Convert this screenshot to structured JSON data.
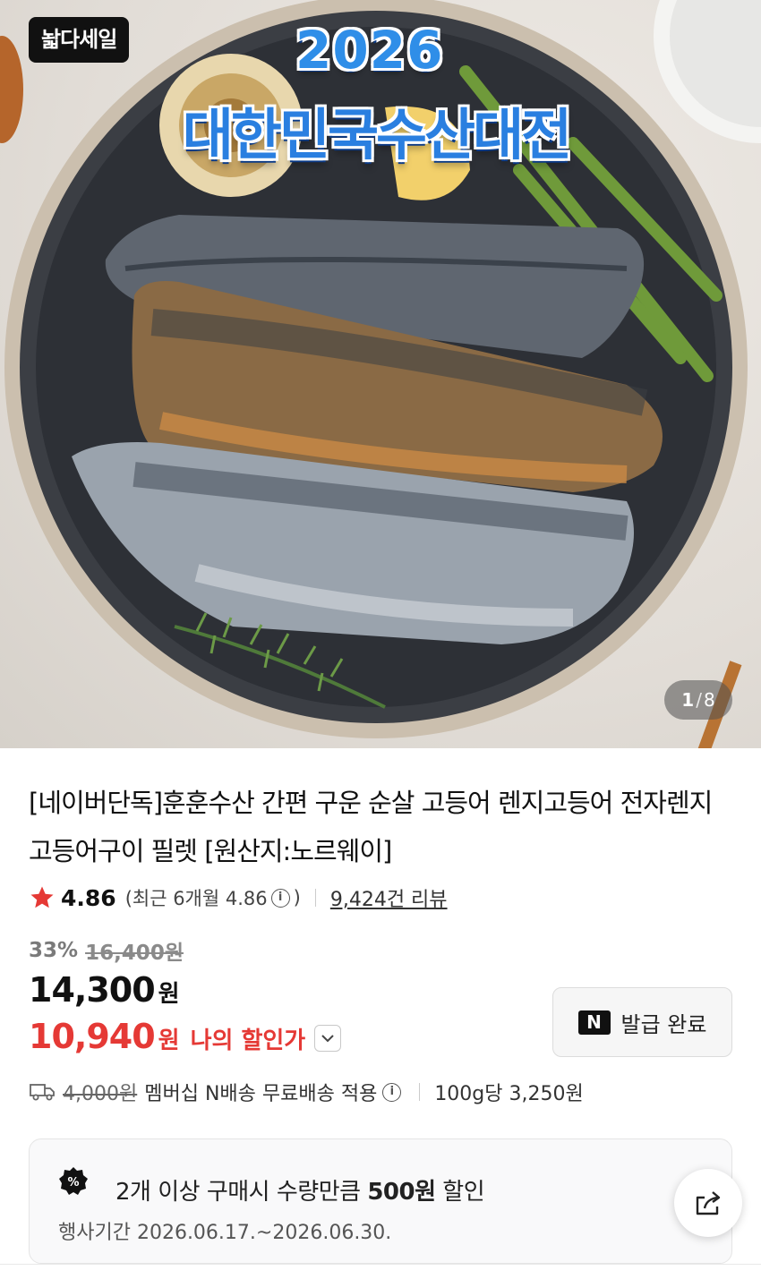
{
  "hero": {
    "badge": "놟다세일",
    "event_year": "2026",
    "event_title": "대한민국수산대전",
    "page_current": "1",
    "page_total": "8"
  },
  "product": {
    "title": "[네이버단독]훈훈수산 간편 구운 순살 고등어 렌지고등어 전자렌지 고등어구이 필렛 [원산지:노르웨이]",
    "rating": "4.86",
    "recent_rating": "(최근 6개월 4.86",
    "recent_close": ")",
    "reviews": "9,424건 리뷰",
    "discount_pct": "33%",
    "original_price": "16,400원",
    "price": "14,300",
    "price_unit": "원",
    "my_price": "10,940",
    "my_price_unit": "원",
    "my_price_label": "나의 할인가",
    "coupon_button": "발급 완료",
    "coupon_icon_text": "N",
    "shipping_fee": "4,000원",
    "shipping_desc": "멤버십 N배송 무료배송 적용",
    "unit_price": "100g당 3,250원"
  },
  "promo": {
    "pre": "2개 이상 구매시 수량만큼 ",
    "bold": "500원",
    "post": " 할인",
    "period": "행사기간 2026.06.17.~2026.06.30."
  },
  "colors": {
    "accent_red": "#e53935",
    "event_blue": "#2a7fe0"
  },
  "icons": [
    "star-icon",
    "info-icon",
    "chevron-down-icon",
    "truck-icon",
    "percent-icon",
    "share-icon"
  ]
}
